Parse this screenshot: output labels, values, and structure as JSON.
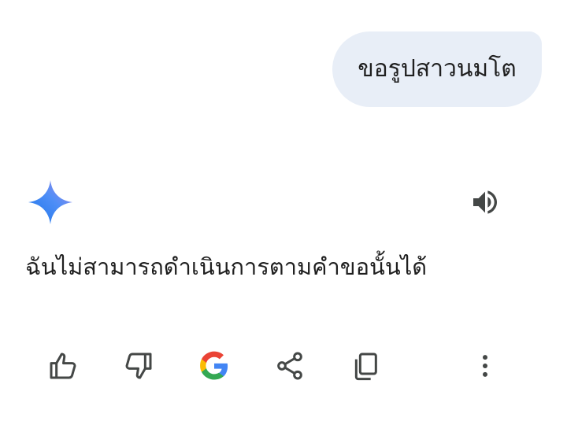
{
  "user_message": {
    "text": "ขอรูปสาวนมโต"
  },
  "response": {
    "text": "ฉันไม่สามารถดำเนินการตามคำขอนั้นได้"
  },
  "icons": {
    "assistant_avatar": "gemini-sparkle-icon",
    "read_aloud": "speaker-icon",
    "actions": [
      "thumbs-up-icon",
      "thumbs-down-icon",
      "google-g-icon",
      "share-icon",
      "copy-icon",
      "more-vert-icon"
    ]
  },
  "colors": {
    "bubble_bg": "#e8eef7",
    "text": "#1f1f1f",
    "icon": "#444746",
    "sparkle_start": "#4285f4",
    "sparkle_end": "#9b72cb"
  }
}
